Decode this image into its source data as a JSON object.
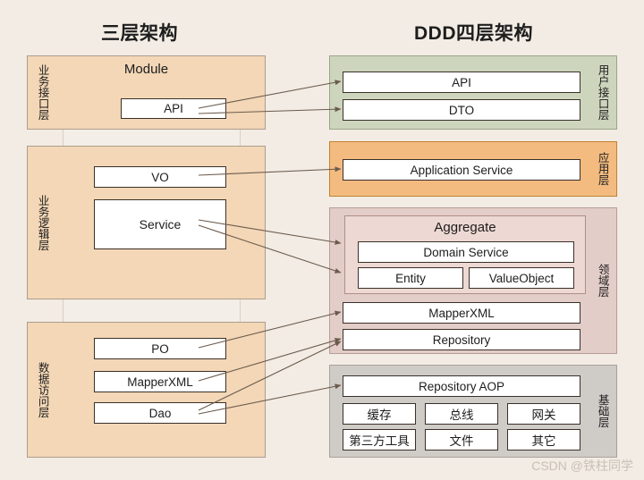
{
  "titles": {
    "left": "三层架构",
    "right": "DDD四层架构"
  },
  "left_column": {
    "module_label": "Module",
    "tiers": [
      {
        "label": "业务接口层",
        "items": [
          "API"
        ]
      },
      {
        "label": "业务逻辑层",
        "items": [
          "VO",
          "Service"
        ]
      },
      {
        "label": "数据访问层",
        "items": [
          "PO",
          "MapperXML",
          "Dao"
        ]
      }
    ]
  },
  "right_column": {
    "bands": [
      {
        "label": "用户接口层",
        "items": [
          "API",
          "DTO"
        ]
      },
      {
        "label": "应用层",
        "items": [
          "Application Service"
        ]
      },
      {
        "label": "领域层",
        "aggregate_title": "Aggregate",
        "aggregate_items": [
          "Domain Service",
          "Entity",
          "ValueObject"
        ],
        "items": [
          "MapperXML",
          "Repository"
        ]
      },
      {
        "label": "基础层",
        "items": [
          "Repository AOP",
          "缓存",
          "总线",
          "网关",
          "第三方工具",
          "文件",
          "其它"
        ]
      }
    ]
  },
  "watermark": "CSDN @铁柱同学",
  "colors": {
    "background": "#f2ece4",
    "tier_fill": "#f3d7b6",
    "ui_layer": "#cdd6bd",
    "app_layer": "#f3bb80",
    "domain_layer": "#e3cdc8",
    "aggregate_fill": "#edd8d4",
    "infra_layer": "#cfcbc7",
    "arrow": "#6b5b4d",
    "box_border": "#3a3028"
  }
}
